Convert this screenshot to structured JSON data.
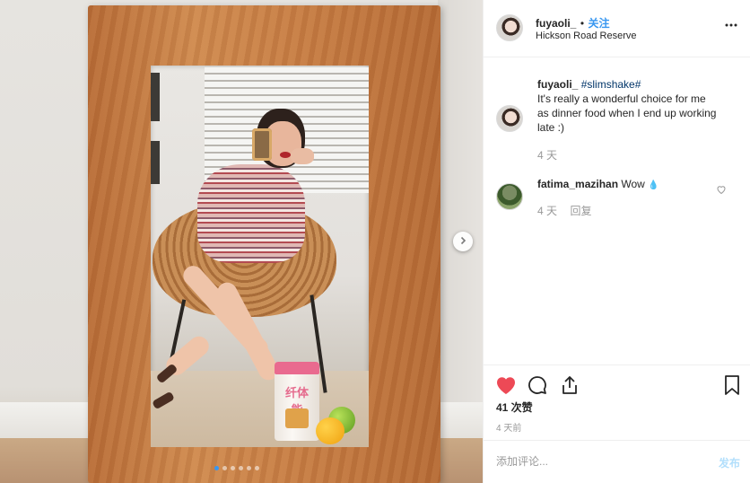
{
  "post": {
    "author": "fuyaoli_",
    "separator": "•",
    "follow_label": "关注",
    "location": "Hickson Road Reserve",
    "more_icon": "more-horizontal-icon"
  },
  "photo": {
    "carousel_count": 6,
    "carousel_active": 1,
    "product_text": "纤体能"
  },
  "caption": {
    "author": "fuyaoli_",
    "hashtag": "#slimshake#",
    "text_line1": "It's really a wonderful choice for me",
    "text_line2": "as dinner food when I end up working",
    "text_line3": "late :)",
    "age": "4 天"
  },
  "comments": [
    {
      "author": "fatima_mazihan",
      "text": "Wow",
      "emoji": "💧",
      "age": "4 天",
      "reply_label": "回复"
    }
  ],
  "actions": {
    "like_icon": "heart-filled-icon",
    "comment_icon": "comment-icon",
    "share_icon": "share-icon",
    "save_icon": "bookmark-icon",
    "like_color": "#ed4956"
  },
  "stats": {
    "likes_label": "41 次赞",
    "posted": "4 天前"
  },
  "compose": {
    "placeholder": "添加评论...",
    "post_label": "发布"
  }
}
